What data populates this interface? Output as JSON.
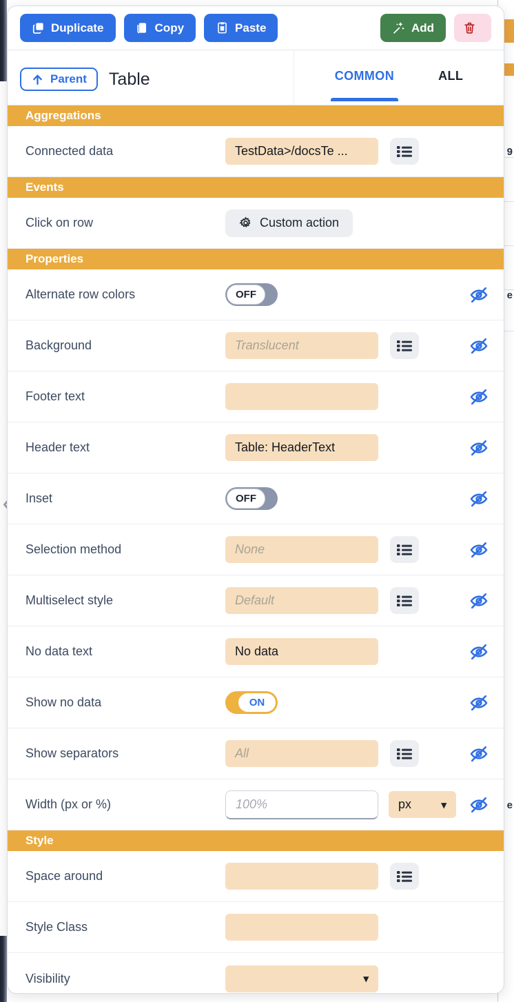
{
  "toolbar": {
    "duplicate_label": "Duplicate",
    "copy_label": "Copy",
    "paste_label": "Paste",
    "add_label": "Add",
    "delete_label": ""
  },
  "header": {
    "parent_label": "Parent",
    "element_title": "Table",
    "tabs": [
      {
        "label": "COMMON",
        "active": true
      },
      {
        "label": "ALL",
        "active": false
      }
    ]
  },
  "colors": {
    "accent_blue": "#2f6fe4",
    "section_amber": "#e9ab40",
    "field_amber": "#f7debe",
    "toggle_off": "#8b95ab",
    "toggle_on": "#eeb240",
    "add_green": "#43824c",
    "delete_pink": "#fadbe6",
    "delete_red": "#b81d1d",
    "label_text": "#3d4a60"
  },
  "sections": [
    {
      "title": "Aggregations",
      "rows": [
        {
          "label": "Connected data",
          "control": "field",
          "value": "TestData>/docsTe ...",
          "placeholder": "",
          "list_button": true,
          "eye": false
        }
      ]
    },
    {
      "title": "Events",
      "rows": [
        {
          "label": "Click on row",
          "control": "action",
          "value": "Custom action",
          "icon": "gear-icon",
          "eye": false
        }
      ]
    },
    {
      "title": "Properties",
      "rows": [
        {
          "label": "Alternate row colors",
          "control": "toggle",
          "value": "OFF",
          "state": "off",
          "eye": true
        },
        {
          "label": "Background",
          "control": "field",
          "value": "",
          "placeholder": "Translucent",
          "list_button": true,
          "eye": true
        },
        {
          "label": "Footer text",
          "control": "field",
          "value": "",
          "placeholder": "",
          "list_button": false,
          "eye": true
        },
        {
          "label": "Header text",
          "control": "field",
          "value": "Table: HeaderText",
          "placeholder": "",
          "list_button": false,
          "eye": true
        },
        {
          "label": "Inset",
          "control": "toggle",
          "value": "OFF",
          "state": "off",
          "eye": true
        },
        {
          "label": "Selection method",
          "control": "field",
          "value": "",
          "placeholder": "None",
          "list_button": true,
          "eye": true
        },
        {
          "label": "Multiselect style",
          "control": "field",
          "value": "",
          "placeholder": "Default",
          "list_button": true,
          "eye": true
        },
        {
          "label": "No data text",
          "control": "field",
          "value": "No data",
          "placeholder": "",
          "list_button": false,
          "eye": true
        },
        {
          "label": "Show no data",
          "control": "toggle",
          "value": "ON",
          "state": "on",
          "eye": true
        },
        {
          "label": "Show separators",
          "control": "field",
          "value": "",
          "placeholder": "All",
          "list_button": true,
          "eye": true
        },
        {
          "label": "Width (px or %)",
          "control": "input-unit",
          "value": "",
          "placeholder": "100%",
          "unit": "px",
          "eye": true
        }
      ]
    },
    {
      "title": "Style",
      "rows": [
        {
          "label": "Space around",
          "control": "field",
          "value": "",
          "placeholder": "",
          "list_button": true,
          "eye": false
        },
        {
          "label": "Style Class",
          "control": "field",
          "value": "",
          "placeholder": "",
          "list_button": false,
          "eye": false
        },
        {
          "label": "Visibility",
          "control": "select",
          "value": "",
          "placeholder": "",
          "eye": false
        }
      ]
    }
  ],
  "background": {
    "fragment_a": "9",
    "fragment_b": "e",
    "fragment_c": "e"
  }
}
